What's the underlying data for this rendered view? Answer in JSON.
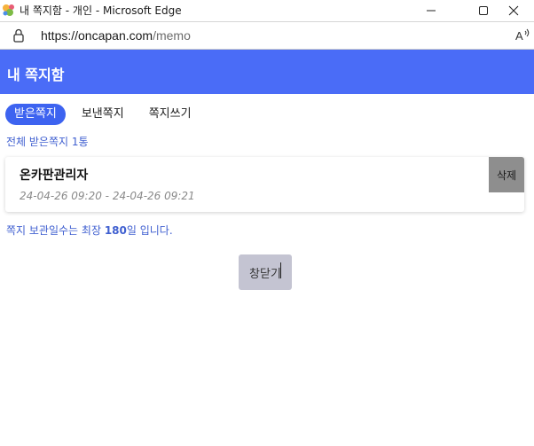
{
  "window": {
    "title": "내 쪽지함 - 개인 - Microsoft Edge"
  },
  "address_bar": {
    "url_host": "https://oncapan.com",
    "url_path": "/memo"
  },
  "header": {
    "title": "내 쪽지함"
  },
  "tabs": [
    {
      "label": "받은쪽지",
      "active": true
    },
    {
      "label": "보낸쪽지",
      "active": false
    },
    {
      "label": "쪽지쓰기",
      "active": false
    }
  ],
  "inbox": {
    "total_label": "전체 받은쪽지 1통",
    "memos": [
      {
        "sender": "온카판관리자",
        "date_range": "24-04-26 09:20 - 24-04-26 09:21",
        "delete_label": "삭제"
      }
    ],
    "retention_prefix": "쪽지 보관일수는 최장 ",
    "retention_days": "180",
    "retention_suffix": "일 입니다."
  },
  "actions": {
    "close_label": "창닫기"
  },
  "colors": {
    "header_bg": "#4a6cf7",
    "active_tab_bg": "#3d63f0",
    "link_text": "#3f5fd0",
    "delete_bg": "#8e8e8e",
    "close_bg": "#c4c4d2"
  }
}
